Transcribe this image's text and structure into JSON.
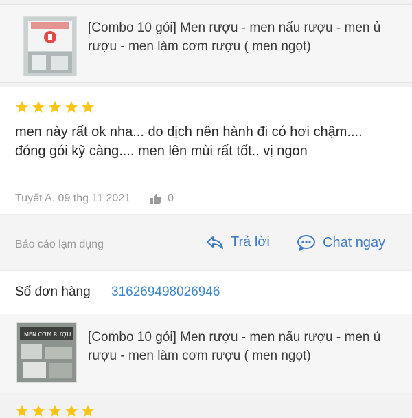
{
  "product1": {
    "title": "[Combo 10 gói] Men rượu - men nấu rượu - men ủ rượu - men làm cơm rượu ( men ngọt)"
  },
  "review": {
    "rating": 5,
    "text": "men này rất ok nha... do dịch nên hành đi có hơi chậm.... đóng gói kỹ càng.... men lên mùi rất tốt.. vị ngon",
    "author_date": "Tuyết A. 09 thg 11 2021",
    "likes": "0"
  },
  "actions": {
    "report": "Báo cáo lạm dụng",
    "reply": "Trả lời",
    "chat": "Chat ngay"
  },
  "order": {
    "label": "Số đơn hàng",
    "number": "316269498026946"
  },
  "product2": {
    "title": "[Combo 10 gói] Men rượu - men nấu rượu - men ủ rượu - men làm cơm rượu ( men ngọt)",
    "thumb_label": "MEN CƠM RƯỢU"
  },
  "colors": {
    "star": "#f5c518",
    "link": "#3f7bc4",
    "order_number": "#3f86c8"
  }
}
